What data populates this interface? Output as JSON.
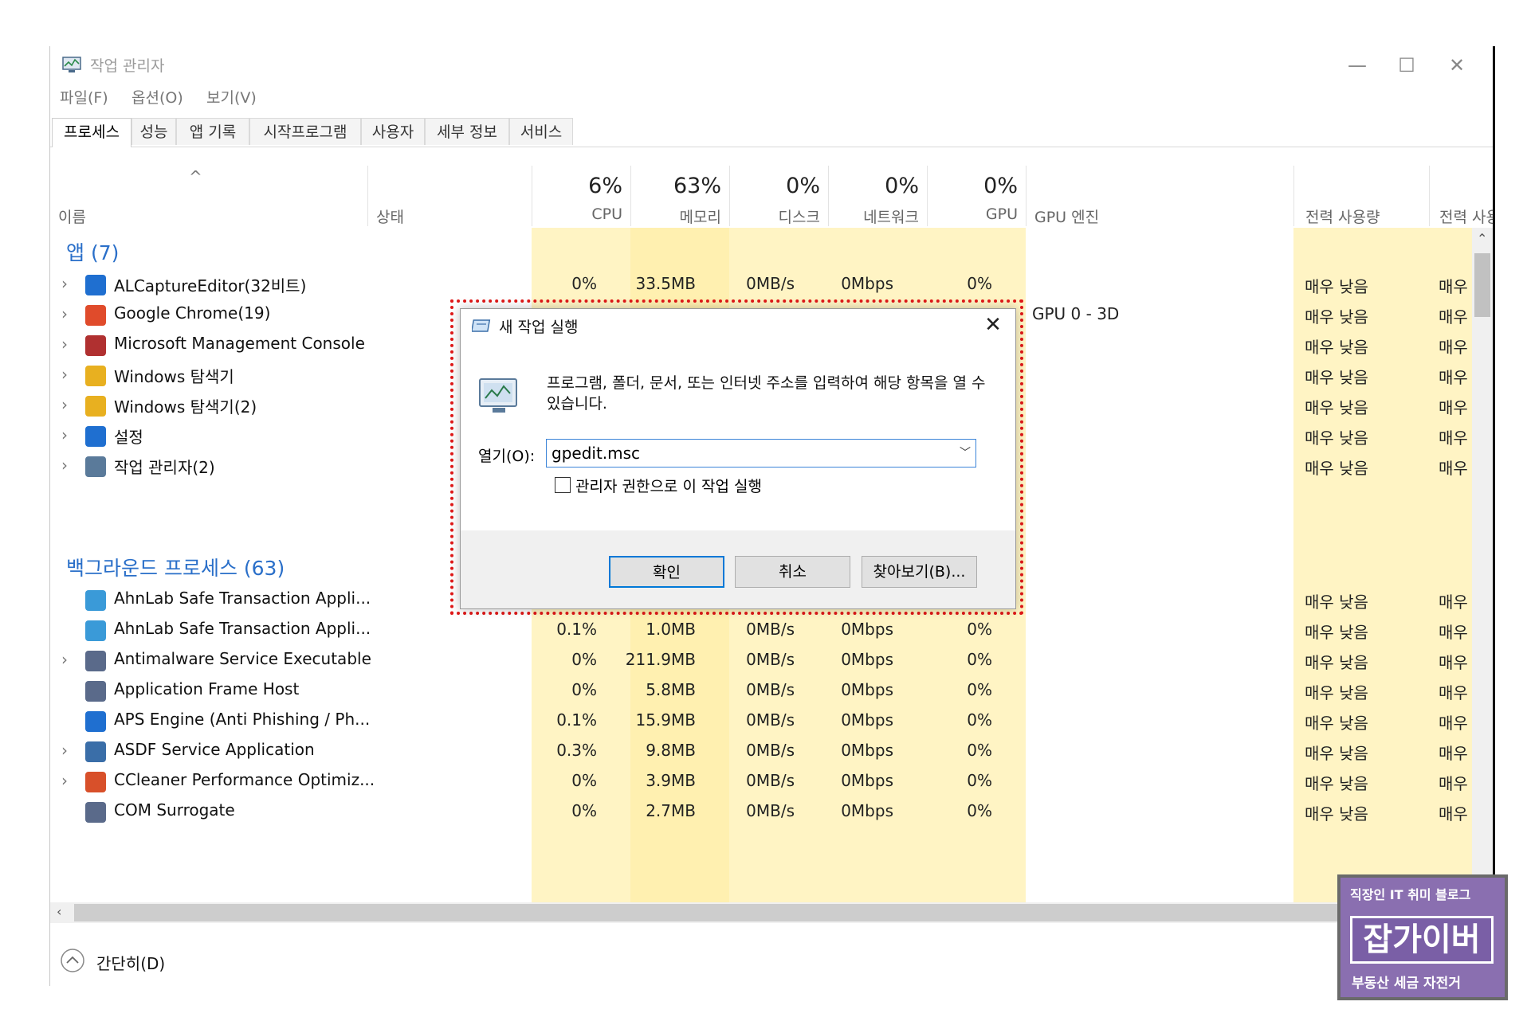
{
  "window": {
    "title": "작업 관리자",
    "controls": {
      "minimize": "—",
      "maximize": "☐",
      "close": "✕"
    }
  },
  "menu": [
    "파일(F)",
    "옵션(O)",
    "보기(V)"
  ],
  "tabs": [
    "프로세스",
    "성능",
    "앱 기록",
    "시작프로그램",
    "사용자",
    "세부 정보",
    "서비스"
  ],
  "columns": {
    "sort_indicator": "^",
    "name": "이름",
    "status": "상태",
    "cpu": {
      "pct": "6%",
      "label": "CPU"
    },
    "memory": {
      "pct": "63%",
      "label": "메모리"
    },
    "disk": {
      "pct": "0%",
      "label": "디스크"
    },
    "network": {
      "pct": "0%",
      "label": "네트워크"
    },
    "gpu": {
      "pct": "0%",
      "label": "GPU"
    },
    "gpu_engine": "GPU 엔진",
    "power": "전력 사용량",
    "power_trend": "전력 사용"
  },
  "groups": {
    "apps": "앱 (7)",
    "background": "백그라운드 프로세스 (63)"
  },
  "apps": [
    {
      "name": "ALCaptureEditor(32비트)",
      "cpu": "0%",
      "mem": "33.5MB",
      "disk": "0MB/s",
      "net": "0Mbps",
      "gpu": "0%",
      "gpu_engine": "",
      "power": "매우 낮음",
      "power2": "매우 낮"
    },
    {
      "name": "Google Chrome(19)",
      "cpu": "",
      "mem": "",
      "disk": "",
      "net": "",
      "gpu": "",
      "gpu_engine": "GPU 0 - 3D",
      "power": "매우 낮음",
      "power2": "매우 낮"
    },
    {
      "name": "Microsoft Management Console",
      "cpu": "",
      "mem": "",
      "disk": "",
      "net": "",
      "gpu": "",
      "gpu_engine": "",
      "power": "매우 낮음",
      "power2": "매우 낮"
    },
    {
      "name": "Windows 탐색기",
      "cpu": "",
      "mem": "",
      "disk": "",
      "net": "",
      "gpu": "",
      "gpu_engine": "",
      "power": "매우 낮음",
      "power2": "매우 낮"
    },
    {
      "name": "Windows 탐색기(2)",
      "cpu": "",
      "mem": "",
      "disk": "",
      "net": "",
      "gpu": "",
      "gpu_engine": "",
      "power": "매우 낮음",
      "power2": "매우 낮"
    },
    {
      "name": "설정",
      "cpu": "",
      "mem": "",
      "disk": "",
      "net": "",
      "gpu": "",
      "gpu_engine": "",
      "power": "매우 낮음",
      "power2": "매우 낮"
    },
    {
      "name": "작업 관리자(2)",
      "cpu": "",
      "mem": "",
      "disk": "",
      "net": "",
      "gpu": "",
      "gpu_engine": "",
      "power": "매우 낮음",
      "power2": "매우 낮"
    }
  ],
  "background": [
    {
      "name": "AhnLab Safe Transaction Appli...",
      "cpu": "",
      "mem": "",
      "disk": "",
      "net": "",
      "gpu": "",
      "power": "매우 낮음",
      "power2": "매우 낮"
    },
    {
      "name": "AhnLab Safe Transaction Appli...",
      "cpu": "0.1%",
      "mem": "1.0MB",
      "disk": "0MB/s",
      "net": "0Mbps",
      "gpu": "0%",
      "power": "매우 낮음",
      "power2": "매우 낮"
    },
    {
      "name": "Antimalware Service Executable",
      "cpu": "0%",
      "mem": "211.9MB",
      "disk": "0MB/s",
      "net": "0Mbps",
      "gpu": "0%",
      "power": "매우 낮음",
      "power2": "매우 낮"
    },
    {
      "name": "Application Frame Host",
      "cpu": "0%",
      "mem": "5.8MB",
      "disk": "0MB/s",
      "net": "0Mbps",
      "gpu": "0%",
      "power": "매우 낮음",
      "power2": "매우 낮"
    },
    {
      "name": "APS Engine (Anti Phishing / Ph...",
      "cpu": "0.1%",
      "mem": "15.9MB",
      "disk": "0MB/s",
      "net": "0Mbps",
      "gpu": "0%",
      "power": "매우 낮음",
      "power2": "매우 낮"
    },
    {
      "name": "ASDF Service Application",
      "cpu": "0.3%",
      "mem": "9.8MB",
      "disk": "0MB/s",
      "net": "0Mbps",
      "gpu": "0%",
      "power": "매우 낮음",
      "power2": "매우 낮"
    },
    {
      "name": "CCleaner Performance Optimiz...",
      "cpu": "0%",
      "mem": "3.9MB",
      "disk": "0MB/s",
      "net": "0Mbps",
      "gpu": "0%",
      "power": "매우 낮음",
      "power2": "매우 낮"
    },
    {
      "name": "COM Surrogate",
      "cpu": "0%",
      "mem": "2.7MB",
      "disk": "0MB/s",
      "net": "0Mbps",
      "gpu": "0%",
      "power": "매우 낮음",
      "power2": "매우 낮"
    }
  ],
  "footer": {
    "fewer_details": "간단히(D)"
  },
  "dialog": {
    "title": "새 작업 실행",
    "close": "✕",
    "description": "프로그램, 폴더, 문서, 또는 인터넷 주소를 입력하여 해당 항목을 열 수 있습니다.",
    "open_label": "열기(O):",
    "open_value": "gpedit.msc",
    "admin_checkbox": "관리자 권한으로 이 작업 실행",
    "ok": "확인",
    "cancel": "취소",
    "browse": "찾아보기(B)..."
  },
  "watermark": {
    "line1": "직장인 IT 취미 블로그",
    "line2": "잡가이버",
    "line3": "부동산 세금 자전거"
  },
  "colors": {
    "heat_light": "#fff4c4",
    "heat_mid": "#fff0b0",
    "group_blue": "#2a6fc9",
    "dialog_outline": "#e01818",
    "accent": "#0078d7"
  }
}
